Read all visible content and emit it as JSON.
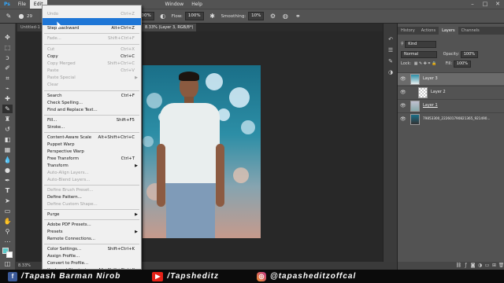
{
  "menubar": {
    "items": [
      "File",
      "Edit"
    ],
    "window_label": "Window",
    "help_label": "Help"
  },
  "options": {
    "brush_size": "29",
    "opacity_value": "100%",
    "flow_label": "Flow:",
    "flow_value": "100%",
    "smoothing_label": "Smoothing:",
    "smoothing_value": "10%"
  },
  "document": {
    "tab1": "Untitled-1",
    "tab2": "8.33% (Layer 3, RGB/8*)",
    "zoom": "8.33%"
  },
  "edit_menu": {
    "items": [
      {
        "label": "Undo",
        "shortcut": "Ctrl+Z",
        "disabled": true
      },
      {
        "label": "",
        "shortcut": "",
        "highlight": true
      },
      {
        "label": "Step Backward",
        "shortcut": "Alt+Ctrl+Z"
      },
      {
        "label": "Fade...",
        "shortcut": "Shift+Ctrl+F",
        "disabled": true
      },
      {
        "label": "Cut",
        "shortcut": "Ctrl+X",
        "disabled": true
      },
      {
        "label": "Copy",
        "shortcut": "Ctrl+C"
      },
      {
        "label": "Copy Merged",
        "shortcut": "Shift+Ctrl+C",
        "disabled": true
      },
      {
        "label": "Paste",
        "shortcut": "Ctrl+V",
        "disabled": true
      },
      {
        "label": "Paste Special",
        "disabled": true,
        "submenu": true
      },
      {
        "label": "Clear",
        "disabled": true
      },
      {
        "label": "Search",
        "shortcut": "Ctrl+F"
      },
      {
        "label": "Check Spelling..."
      },
      {
        "label": "Find and Replace Text..."
      },
      {
        "label": "Fill...",
        "shortcut": "Shift+F5"
      },
      {
        "label": "Stroke..."
      },
      {
        "label": "Content-Aware Scale",
        "shortcut": "Alt+Shift+Ctrl+C"
      },
      {
        "label": "Puppet Warp"
      },
      {
        "label": "Perspective Warp"
      },
      {
        "label": "Free Transform",
        "shortcut": "Ctrl+T"
      },
      {
        "label": "Transform",
        "submenu": true
      },
      {
        "label": "Auto-Align Layers...",
        "disabled": true
      },
      {
        "label": "Auto-Blend Layers...",
        "disabled": true
      },
      {
        "label": "Define Brush Preset...",
        "disabled": true
      },
      {
        "label": "Define Pattern..."
      },
      {
        "label": "Define Custom Shape...",
        "disabled": true
      },
      {
        "label": "Purge",
        "submenu": true
      },
      {
        "label": "Adobe PDF Presets..."
      },
      {
        "label": "Presets",
        "submenu": true
      },
      {
        "label": "Remote Connections..."
      },
      {
        "label": "Color Settings...",
        "shortcut": "Shift+Ctrl+K"
      },
      {
        "label": "Assign Profile..."
      },
      {
        "label": "Convert to Profile..."
      },
      {
        "label": "Keyboard Shortcuts...",
        "shortcut": "Alt+Shift+Ctrl+K"
      }
    ]
  },
  "panel": {
    "tabs": [
      "History",
      "Actions",
      "Layers",
      "Channels"
    ],
    "kind_label": "Kind",
    "blend_mode": "Normal",
    "opacity_label": "Opacity:",
    "opacity_value": "100%",
    "lock_label": "Lock:",
    "fill_label": "Fill:",
    "fill_value": "100%",
    "layers": [
      {
        "name": "Layer 3",
        "selected": true
      },
      {
        "name": "Layer 2"
      },
      {
        "name": "Layer 1"
      },
      {
        "name": "79853300_2226017908213​65_921490..."
      }
    ]
  },
  "social": {
    "facebook": "/Tapash Barman Nirob",
    "youtube": "/Tapsheditz",
    "instagram": "@tapasheditzoffcal"
  },
  "colors": {
    "menu_highlight": "#1e76d6",
    "facebook": "#3b5998",
    "youtube": "#e62117",
    "instagram": "#c13584"
  }
}
